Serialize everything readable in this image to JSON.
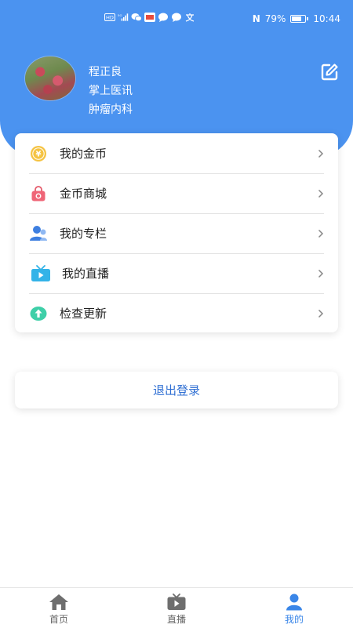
{
  "status_bar": {
    "left_icons": [
      "hd-icon",
      "signal-4g-icon",
      "wechat-icon",
      "app-badge-icon",
      "message-icon",
      "message-icon",
      "translate-icon"
    ],
    "nfc": "N",
    "battery": "79%",
    "battery_level": 0.79,
    "time": "10:44"
  },
  "profile": {
    "name": "程正良",
    "organization": "掌上医讯",
    "department": "肿瘤内科"
  },
  "menu": [
    {
      "label": "我的金币",
      "icon": "gold-coin-icon"
    },
    {
      "label": "金币商城",
      "icon": "shopping-bag-icon"
    },
    {
      "label": "我的专栏",
      "icon": "user-column-icon"
    },
    {
      "label": "我的直播",
      "icon": "tv-live-icon"
    },
    {
      "label": "检查更新",
      "icon": "update-arrow-icon"
    }
  ],
  "logout": {
    "label": "退出登录"
  },
  "tabs": [
    {
      "label": "首页",
      "icon": "home-icon"
    },
    {
      "label": "直播",
      "icon": "tv-play-icon"
    },
    {
      "label": "我的",
      "icon": "person-icon"
    }
  ],
  "colors": {
    "header": "#4b93f0",
    "accent": "#3a86e8",
    "logout_text": "#2f6fd3"
  }
}
